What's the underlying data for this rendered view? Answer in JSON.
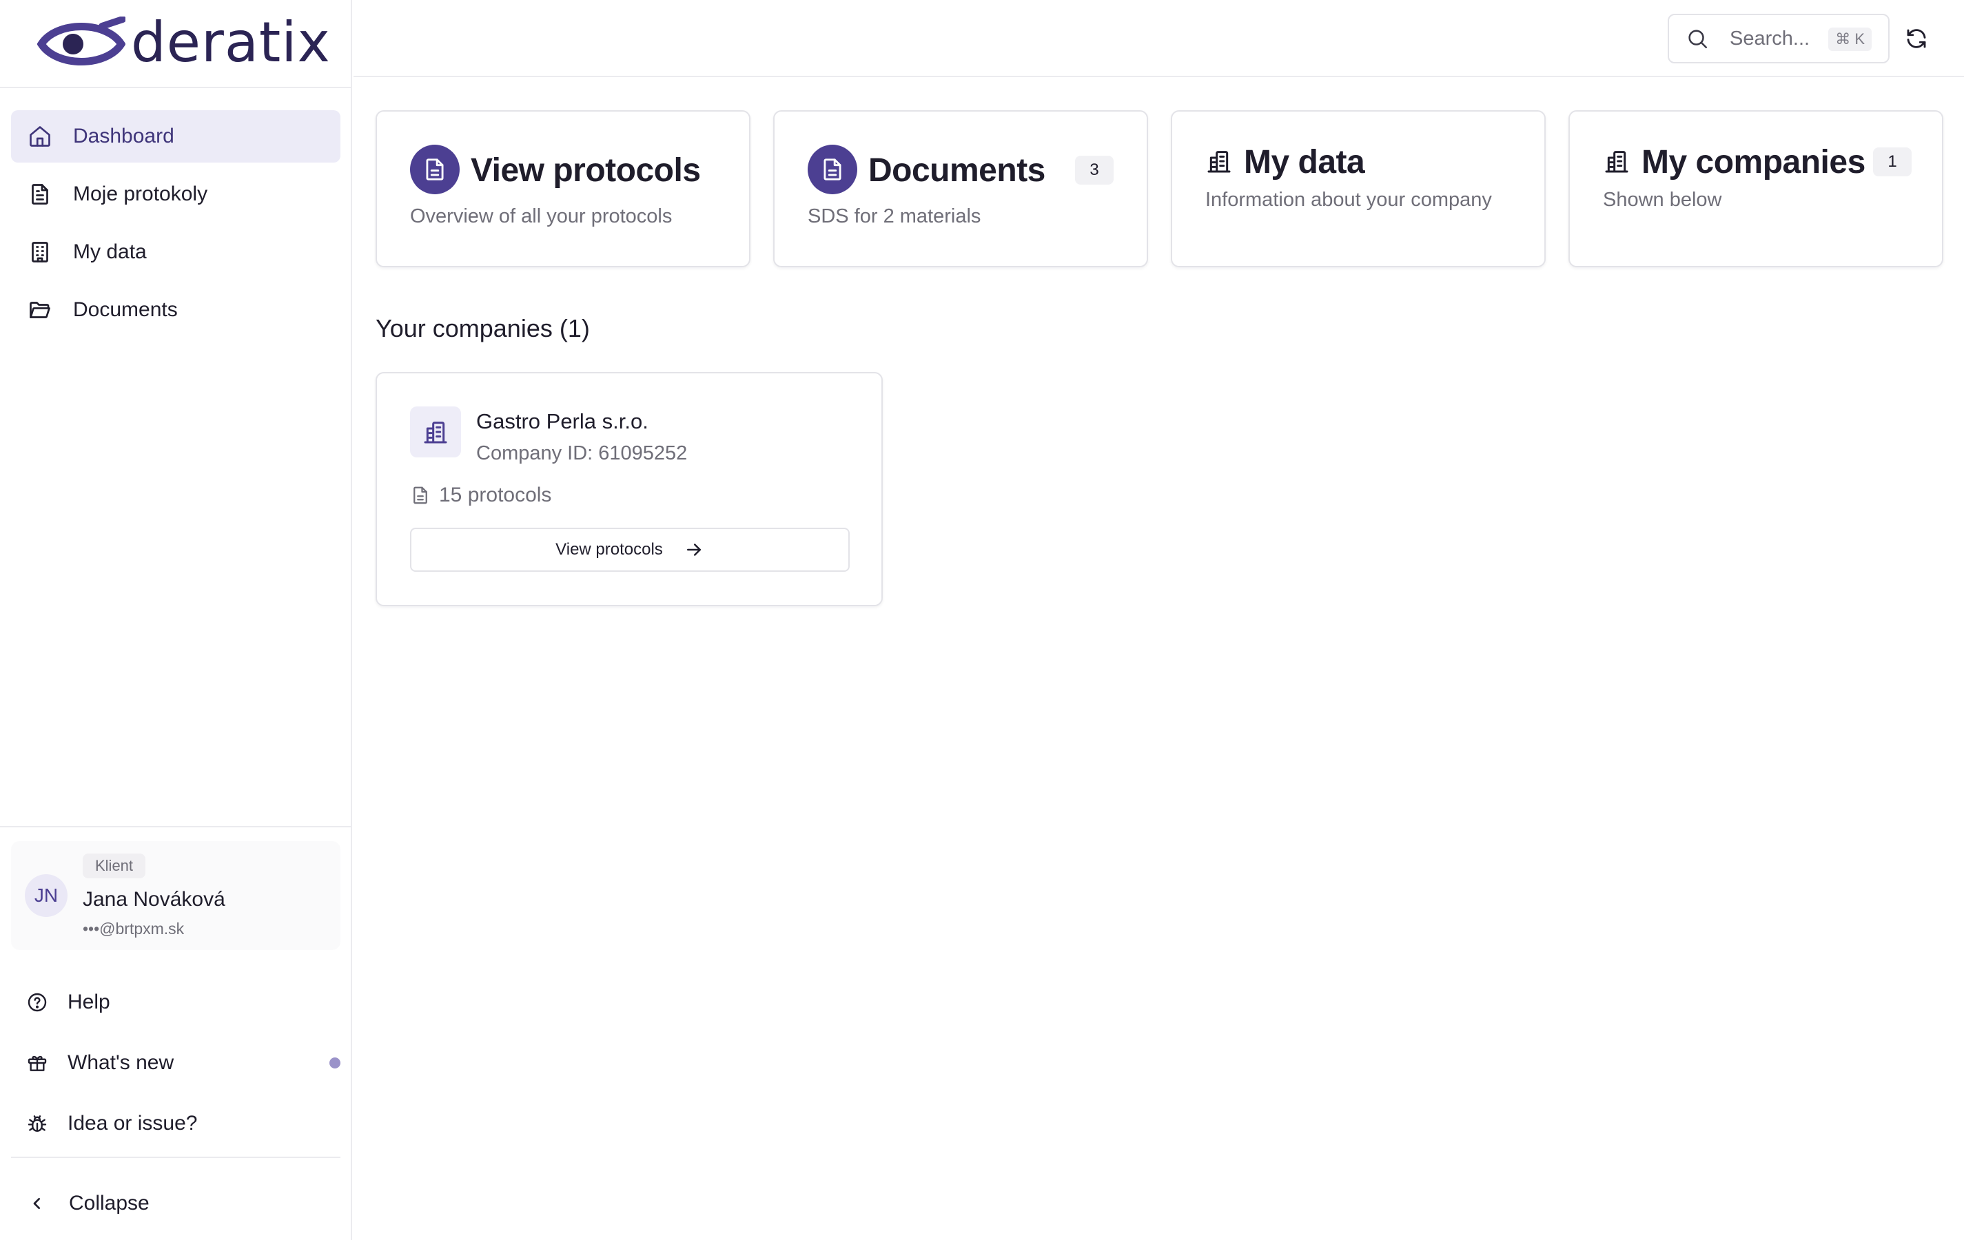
{
  "brand": {
    "name": "deratix",
    "primary_color": "#4c3f92",
    "text_color": "#2b2454"
  },
  "sidebar": {
    "nav": [
      {
        "label": "Dashboard",
        "icon": "home-icon",
        "active": true
      },
      {
        "label": "Moje protokoly",
        "icon": "document-icon",
        "active": false
      },
      {
        "label": "My data",
        "icon": "building-icon",
        "active": false
      },
      {
        "label": "Documents",
        "icon": "folder-icon",
        "active": false
      }
    ],
    "user": {
      "initials": "JN",
      "role": "Klient",
      "name": "Jana Nováková",
      "email": "•••@brtpxm.sk"
    },
    "links": [
      {
        "label": "Help",
        "icon": "help-circle-icon"
      },
      {
        "label": "What's new",
        "icon": "gift-icon",
        "has_new": true
      },
      {
        "label": "Idea or issue?",
        "icon": "bug-icon"
      }
    ],
    "collapse_label": "Collapse"
  },
  "header": {
    "search": {
      "placeholder": "Search...",
      "shortcut": "⌘ K"
    },
    "refresh_icon": "refresh-icon"
  },
  "cards": [
    {
      "title": "View protocols",
      "subtitle": "Overview of all your protocols",
      "icon": "document-icon"
    },
    {
      "title": "Documents",
      "subtitle": "SDS for 2 materials",
      "icon": "document-icon",
      "count": "3"
    },
    {
      "title": "My data",
      "subtitle": "Information about your company",
      "icon": "building-icon"
    },
    {
      "title": "My companies",
      "subtitle": "Shown below",
      "icon": "building-icon",
      "count": "1"
    }
  ],
  "companies_section": {
    "title": "Your companies (1)",
    "items": [
      {
        "name": "Gastro Perla s.r.o.",
        "company_id": "Company ID: 61095252",
        "protocols": "15 protocols",
        "button_label": "View protocols"
      }
    ]
  }
}
